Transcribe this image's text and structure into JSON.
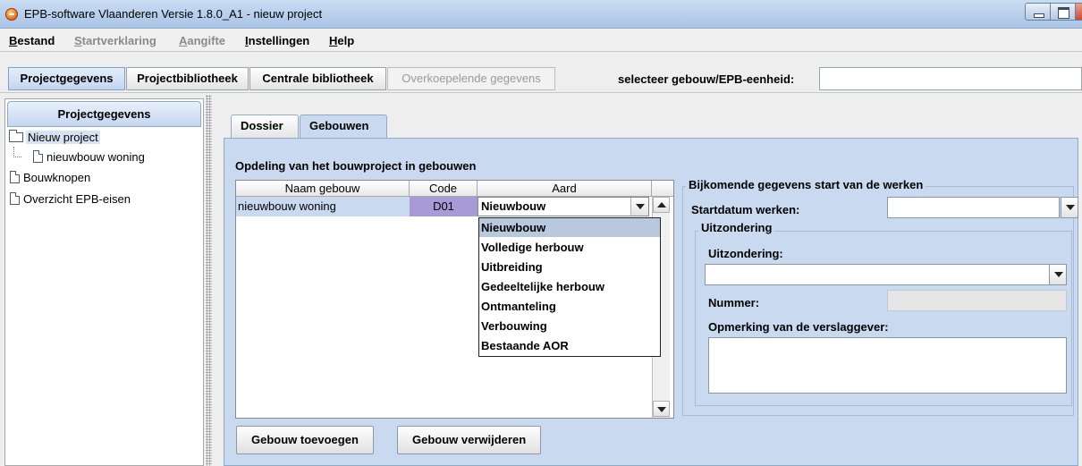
{
  "window": {
    "title": "EPB-software Vlaanderen Versie 1.8.0_A1 - nieuw project"
  },
  "menu": {
    "items": [
      {
        "mnemonic": "B",
        "rest": "estand",
        "enabled": true
      },
      {
        "mnemonic": "S",
        "rest": "tartverklaring",
        "enabled": false
      },
      {
        "mnemonic": "A",
        "rest": "angifte",
        "enabled": false
      },
      {
        "mnemonic": "I",
        "rest": "nstellingen",
        "enabled": true
      },
      {
        "mnemonic": "H",
        "rest": "elp",
        "enabled": true
      }
    ]
  },
  "toolbar": {
    "projectgegevens": "Projectgegevens",
    "projectbibliotheek": "Projectbibliotheek",
    "centrale_bibliotheek": "Centrale bibliotheek",
    "overkoepelende": "Overkoepelende gegevens",
    "select_label": "selecteer gebouw/EPB-eenheid:",
    "select_value": ""
  },
  "sidebar": {
    "header": "Projectgegevens",
    "items": [
      {
        "label": "Nieuw project"
      },
      {
        "label": "nieuwbouw woning"
      },
      {
        "label": "Bouwknopen"
      },
      {
        "label": "Overzicht EPB-eisen"
      }
    ]
  },
  "tabs": [
    {
      "label": "Dossier"
    },
    {
      "label": "Gebouwen"
    }
  ],
  "gebouwen": {
    "section_title": "Opdeling van het bouwproject in gebouwen",
    "columns": [
      "Naam gebouw",
      "Code",
      "Aard"
    ],
    "rows": [
      {
        "naam": "nieuwbouw woning",
        "code": "D01",
        "aard": "Nieuwbouw"
      }
    ],
    "aard_options": [
      "Nieuwbouw",
      "Volledige herbouw",
      "Uitbreiding",
      "Gedeeltelijke herbouw",
      "Ontmanteling",
      "Verbouwing",
      "Bestaande AOR"
    ],
    "add_button": "Gebouw toevoegen",
    "remove_button": "Gebouw verwijderen"
  },
  "start_werken": {
    "section_title": "Bijkomende gegevens start van de werken",
    "startdatum_label": "Startdatum werken:",
    "startdatum_value": "",
    "uitzondering_group": "Uitzondering",
    "uitzondering_label": "Uitzondering:",
    "uitzondering_value": "",
    "nummer_label": "Nummer:",
    "nummer_value": "",
    "opmerking_label": "Opmerking van de verslaggever:",
    "opmerking_value": ""
  },
  "colors": {
    "title_bar": "#b7cfec",
    "panel": "#c9daf0",
    "code_cell": "#a89ad6",
    "selected_option": "#b8c9de"
  }
}
